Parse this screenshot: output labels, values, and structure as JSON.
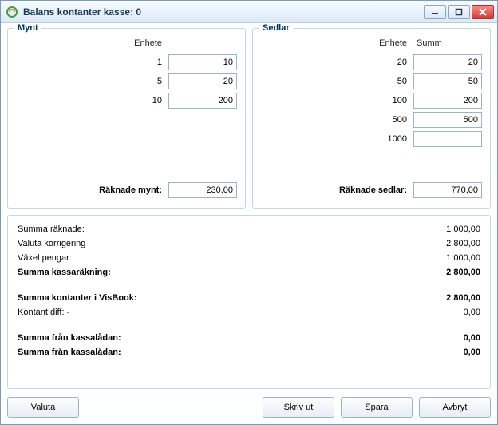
{
  "window": {
    "title": "Balans kontanter kasse: 0"
  },
  "mynt": {
    "legend": "Mynt",
    "unit_header": "Enhete",
    "rows": [
      {
        "label": "1",
        "value": "10"
      },
      {
        "label": "5",
        "value": "20"
      },
      {
        "label": "10",
        "value": "200"
      }
    ],
    "total_label": "Räknade mynt:",
    "total_value": "230,00"
  },
  "sedlar": {
    "legend": "Sedlar",
    "unit_header": "Enhete",
    "sum_header": "Summ",
    "rows": [
      {
        "label": "20",
        "value": "20"
      },
      {
        "label": "50",
        "value": "50"
      },
      {
        "label": "100",
        "value": "200"
      },
      {
        "label": "500",
        "value": "500"
      },
      {
        "label": "1000",
        "value": ""
      }
    ],
    "total_label": "Räknade sedlar:",
    "total_value": "770,00"
  },
  "summary": {
    "lines": [
      {
        "label": "Summa räknade:",
        "value": "1 000,00",
        "bold": false
      },
      {
        "label": "Valuta korrigering",
        "value": "2 800,00",
        "bold": false
      },
      {
        "label": "Växel pengar:",
        "value": "1 000,00",
        "bold": false
      },
      {
        "label": "Summa kassaräkning:",
        "value": "2 800,00",
        "bold": true
      }
    ],
    "lines2": [
      {
        "label": "Summa kontanter i VisBook:",
        "value": "2 800,00",
        "bold": true
      },
      {
        "label": "Kontant diff: -",
        "value": "0,00",
        "bold": false
      }
    ],
    "lines3": [
      {
        "label": "Summa från kassalådan:",
        "value": "0,00",
        "bold": true
      },
      {
        "label": "Summa från kassalådan:",
        "value": "0,00",
        "bold": true
      }
    ]
  },
  "buttons": {
    "valuta": {
      "pre": "",
      "mn": "V",
      "post": "aluta"
    },
    "skriv": {
      "pre": "",
      "mn": "S",
      "post": "kriv ut"
    },
    "spara": {
      "pre": "S",
      "mn": "p",
      "post": "ara"
    },
    "avbryt": {
      "pre": "",
      "mn": "A",
      "post": "vbryt"
    }
  }
}
